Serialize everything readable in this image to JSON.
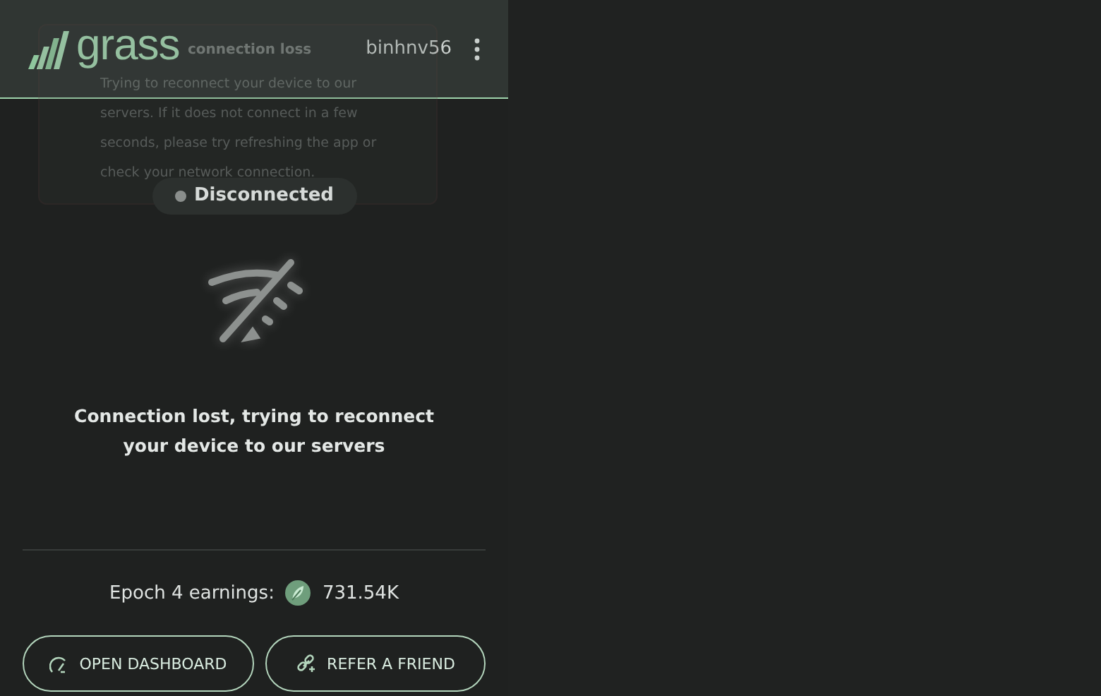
{
  "header": {
    "logo": "grass",
    "username": "binhnv56"
  },
  "toast": {
    "title": "connection loss",
    "message": "Trying to reconnect your device to our servers. If it does not connect in a few seconds, please try refreshing the app or check your network connection."
  },
  "status": {
    "label": "Disconnected",
    "connected": false
  },
  "message": "Connection lost, trying to reconnect your device to our servers",
  "earnings": {
    "label": "Epoch 4 earnings:",
    "value": "731.54K"
  },
  "buttons": [
    {
      "kind": "dashboard",
      "label": "OPEN DASHBOARD"
    },
    {
      "kind": "refer",
      "label": "REFER A FRIEND"
    }
  ]
}
